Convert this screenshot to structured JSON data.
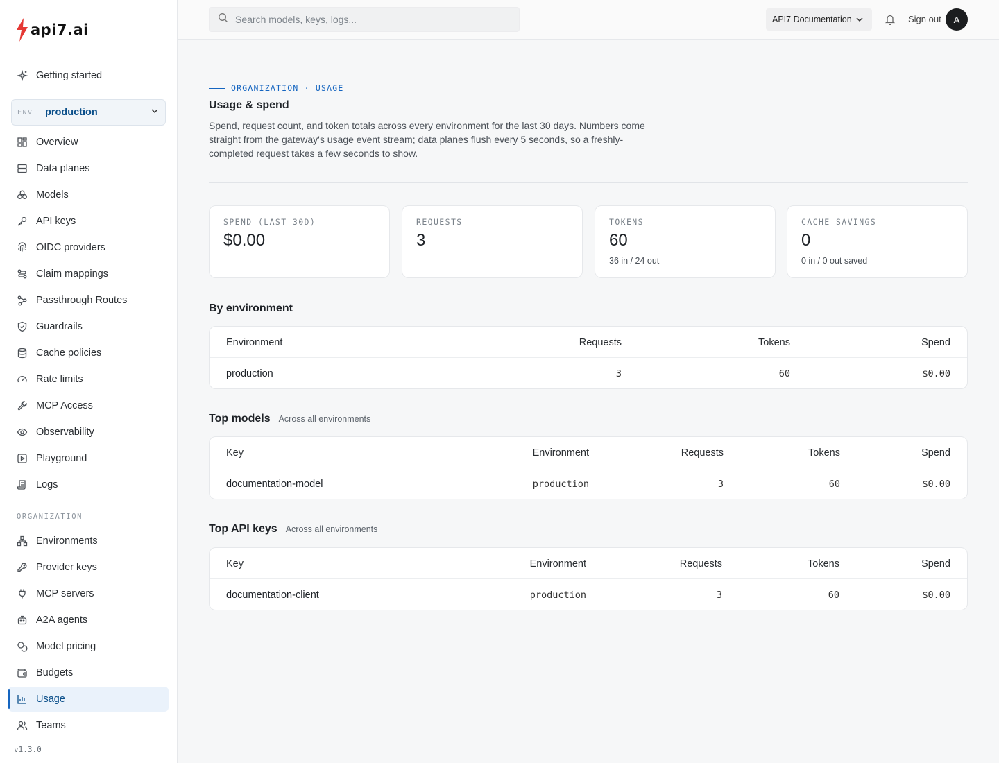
{
  "brand": {
    "logo_text": "api7.ai",
    "accent": "#e53935"
  },
  "sidebar": {
    "getting_started": "Getting started",
    "env_label": "ENV",
    "env_value": "production",
    "env_items": [
      "Overview",
      "Data planes",
      "Models",
      "API keys",
      "OIDC providers",
      "Claim mappings",
      "Passthrough Routes",
      "Guardrails",
      "Cache policies",
      "Rate limits",
      "MCP Access",
      "Observability",
      "Playground",
      "Logs"
    ],
    "org_section_label": "ORGANIZATION",
    "org_items": [
      "Environments",
      "Provider keys",
      "MCP servers",
      "A2A agents",
      "Model pricing",
      "Budgets",
      "Usage",
      "Teams"
    ],
    "active_item": "Usage",
    "version": "v1.3.0"
  },
  "header": {
    "search_placeholder": "Search models, keys, logs...",
    "org_name": "API7 Documentation",
    "sign_out": "Sign out",
    "avatar_initial": "A"
  },
  "page": {
    "eyebrow": "ORGANIZATION · USAGE",
    "title": "Usage & spend",
    "description": "Spend, request count, and token totals across every environment for the last 30 days. Numbers come straight from the gateway's usage event stream; data planes flush every 5 seconds, so a freshly-completed request takes a few seconds to show."
  },
  "stats": [
    {
      "label": "SPEND (LAST 30D)",
      "value": "$0.00",
      "sub": ""
    },
    {
      "label": "REQUESTS",
      "value": "3",
      "sub": ""
    },
    {
      "label": "TOKENS",
      "value": "60",
      "sub": "36 in / 24 out"
    },
    {
      "label": "CACHE SAVINGS",
      "value": "0",
      "sub": "0 in / 0 out saved"
    }
  ],
  "by_environment": {
    "title": "By environment",
    "columns": [
      "Environment",
      "Requests",
      "Tokens",
      "Spend"
    ],
    "rows": [
      [
        "production",
        "3",
        "60",
        "$0.00"
      ]
    ]
  },
  "top_models": {
    "title": "Top models",
    "subtitle": "Across all environments",
    "columns": [
      "Key",
      "Environment",
      "Requests",
      "Tokens",
      "Spend"
    ],
    "rows": [
      [
        "documentation-model",
        "production",
        "3",
        "60",
        "$0.00"
      ]
    ]
  },
  "top_api_keys": {
    "title": "Top API keys",
    "subtitle": "Across all environments",
    "columns": [
      "Key",
      "Environment",
      "Requests",
      "Tokens",
      "Spend"
    ],
    "rows": [
      [
        "documentation-client",
        "production",
        "3",
        "60",
        "$0.00"
      ]
    ]
  }
}
